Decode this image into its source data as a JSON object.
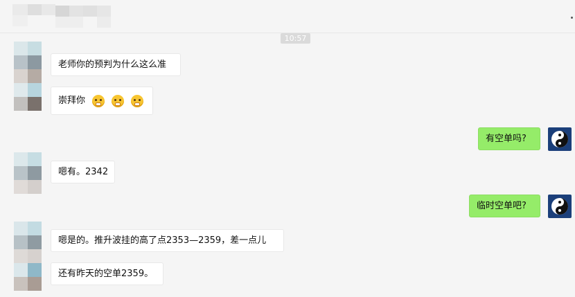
{
  "header": {
    "title_blurred": true
  },
  "timestamp": "10:57",
  "messages": [
    {
      "side": "left",
      "text": "老师你的预判为什么这么准"
    },
    {
      "side": "left",
      "text": "崇拜你",
      "emoji_count": 3
    },
    {
      "side": "right",
      "text": "有空单吗?"
    },
    {
      "side": "left",
      "text": "嗯有。2342"
    },
    {
      "side": "right",
      "text": "临时空单吧?"
    },
    {
      "side": "left",
      "text": "嗯是的。推升波挂的高了点2353—2359，差一点儿"
    },
    {
      "side": "left",
      "text": "还有昨天的空单2359。"
    }
  ],
  "colors": {
    "self_bubble": "#95ec69",
    "other_bubble": "#ffffff",
    "background": "#f5f5f5"
  }
}
